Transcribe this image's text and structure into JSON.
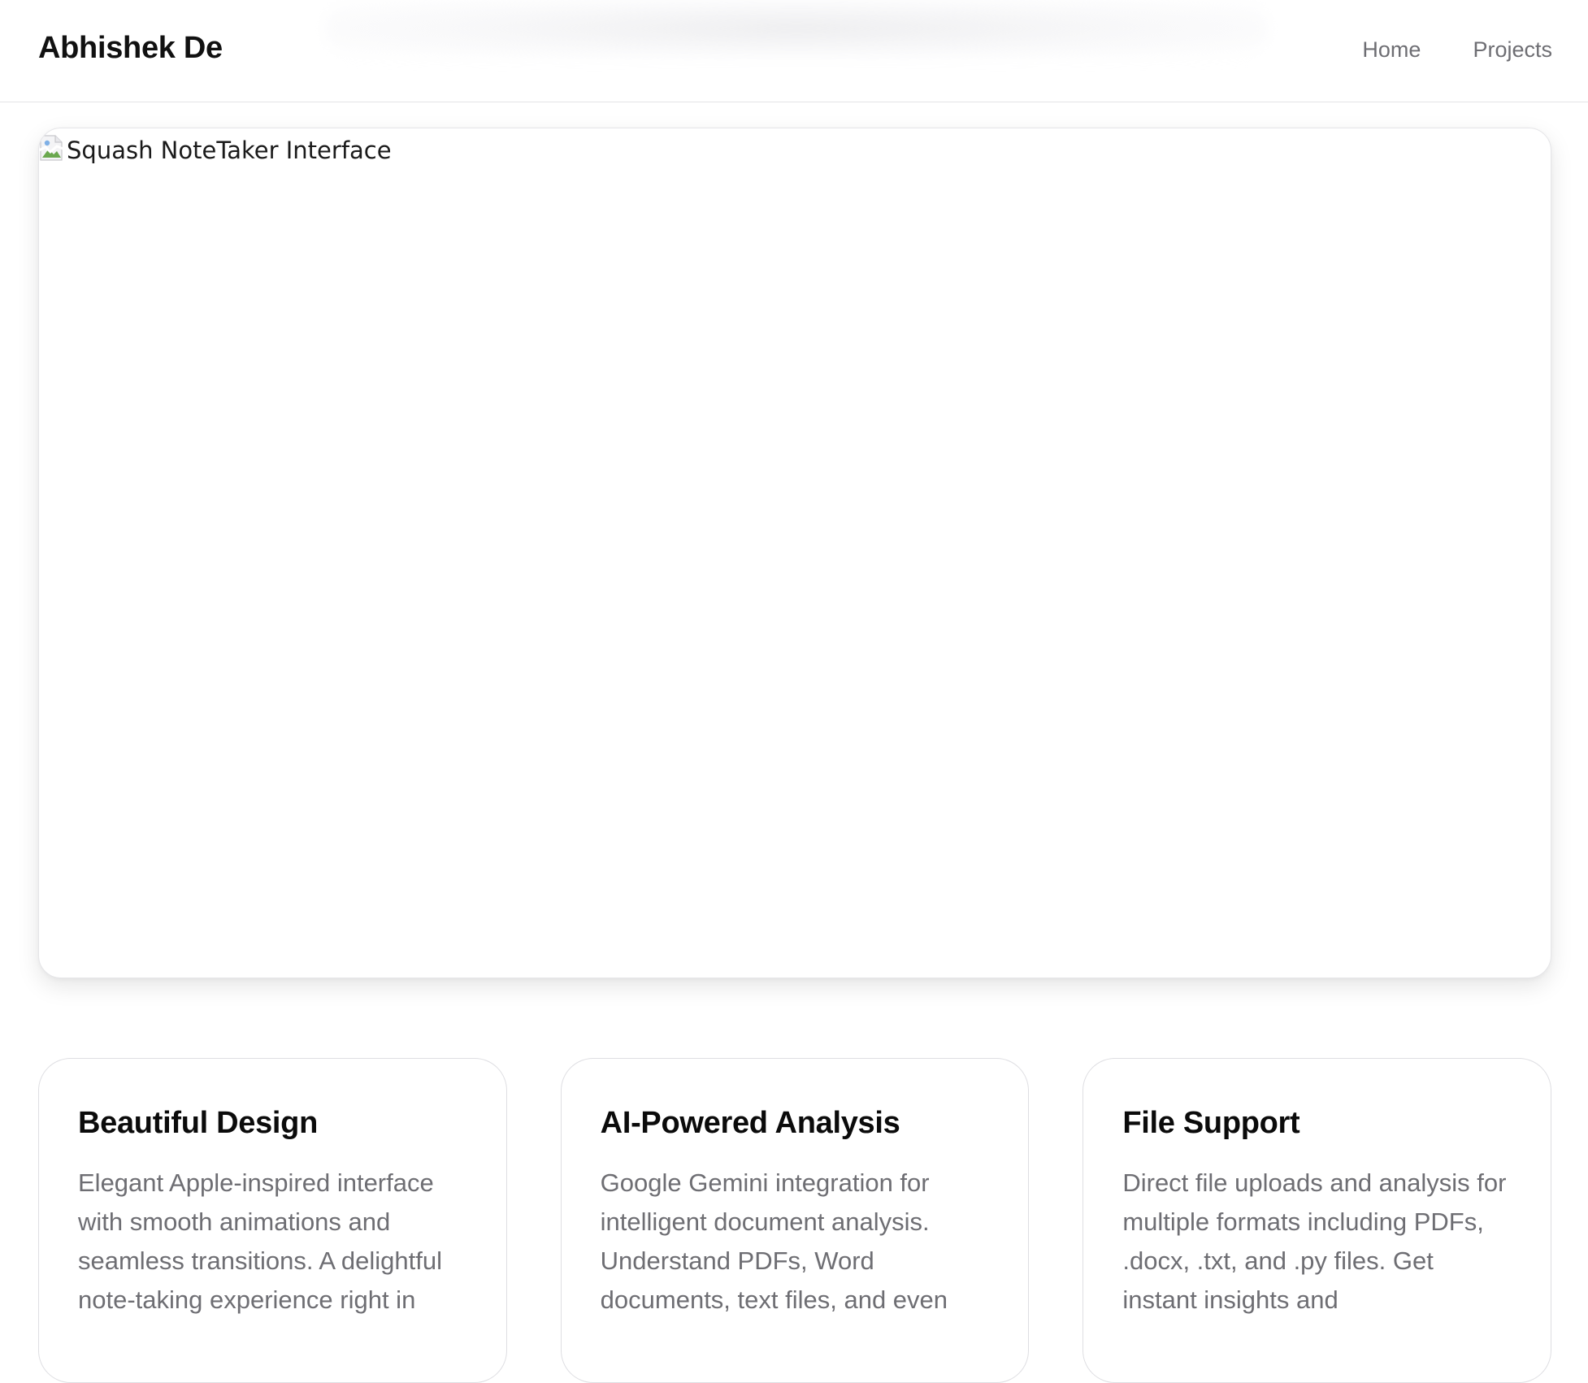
{
  "header": {
    "brand": "Abhishek De",
    "nav": [
      {
        "label": "Home"
      },
      {
        "label": "Projects"
      }
    ]
  },
  "hero": {
    "image_alt": "Squash NoteTaker Interface",
    "icon": "broken-image-icon"
  },
  "features": [
    {
      "title": "Beautiful Design",
      "description": "Elegant Apple-inspired interface with smooth animations and seamless transitions. A delightful note-taking experience right in"
    },
    {
      "title": "AI-Powered Analysis",
      "description": "Google Gemini integration for intelligent document analysis. Understand PDFs, Word documents, text files, and even"
    },
    {
      "title": "File Support",
      "description": "Direct file uploads and analysis for multiple formats including PDFs, .docx, .txt, and .py files. Get instant insights and"
    }
  ],
  "colors": {
    "text_primary": "#1d1d1f",
    "text_secondary": "#6e6e73",
    "border": "#e3e3e6",
    "background": "#ffffff"
  }
}
